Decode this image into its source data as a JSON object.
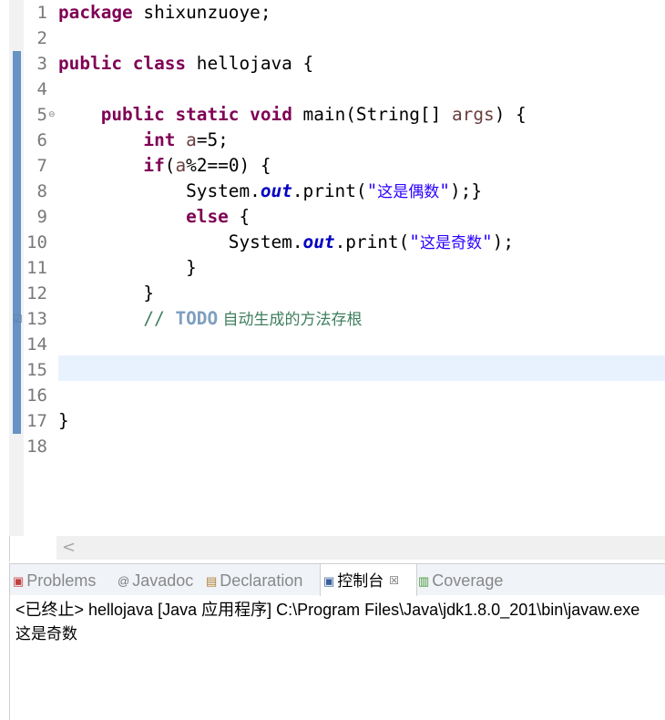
{
  "editor": {
    "line_numbers": [
      "1",
      "2",
      "3",
      "4",
      "5",
      "6",
      "7",
      "8",
      "9",
      "10",
      "11",
      "12",
      "13",
      "14",
      "15",
      "16",
      "17",
      "18"
    ],
    "code": {
      "l1_kw": "package",
      "l1_rest": " shixunzuoye;",
      "l3_kw1": "public",
      "l3_kw2": "class",
      "l3_rest": " hellojava {",
      "l5_kw1": "public",
      "l5_kw2": "static",
      "l5_kw3": "void",
      "l5_mid": " main(String[] ",
      "l5_var": "args",
      "l5_end": ") {",
      "l6_kw": "int",
      "l6_var": "a",
      "l6_rest": "=5;",
      "l7_kw": "if",
      "l7_open": "(",
      "l7_var": "a",
      "l7_rest": "%2==0) {",
      "l8_sys": "System.",
      "l8_out": "out",
      "l8_print": ".print(",
      "l8_q1": "\"",
      "l8_str": "这是偶数",
      "l8_q2": "\"",
      "l8_end": ");}",
      "l9_kw": "else",
      "l9_rest": " {",
      "l10_sys": "System.",
      "l10_out": "out",
      "l10_print": ".print(",
      "l10_q1": "\"",
      "l10_str": "这是奇数",
      "l10_q2": "\"",
      "l10_end": ");",
      "l11": "}",
      "l12": "}",
      "l13_slashes": "// ",
      "l13_todo": "TODO",
      "l13_text": " 自动生成的方法存根",
      "l17": "}"
    }
  },
  "scrollbar": {
    "left_arrow": "<"
  },
  "panel": {
    "tabs": [
      {
        "label": "Problems",
        "icon": "problems-icon"
      },
      {
        "label": "Javadoc",
        "icon": "javadoc-icon"
      },
      {
        "label": "Declaration",
        "icon": "declaration-icon"
      },
      {
        "label": "控制台",
        "icon": "console-icon",
        "active": true,
        "close": "☒"
      },
      {
        "label": "Coverage",
        "icon": "coverage-icon"
      }
    ],
    "console_header": "<已终止> hellojava [Java 应用程序] C:\\Program Files\\Java\\jdk1.8.0_201\\bin\\javaw.exe",
    "console_output": "这是奇数"
  },
  "colors": {
    "keyword": "#7f0055",
    "static_field": "#0000c0",
    "string": "#2a00ff",
    "comment": "#3f7f5f",
    "todo": "#7f9fbf",
    "current_line": "#e8f2fe",
    "change_bar": "#4f81bd"
  }
}
